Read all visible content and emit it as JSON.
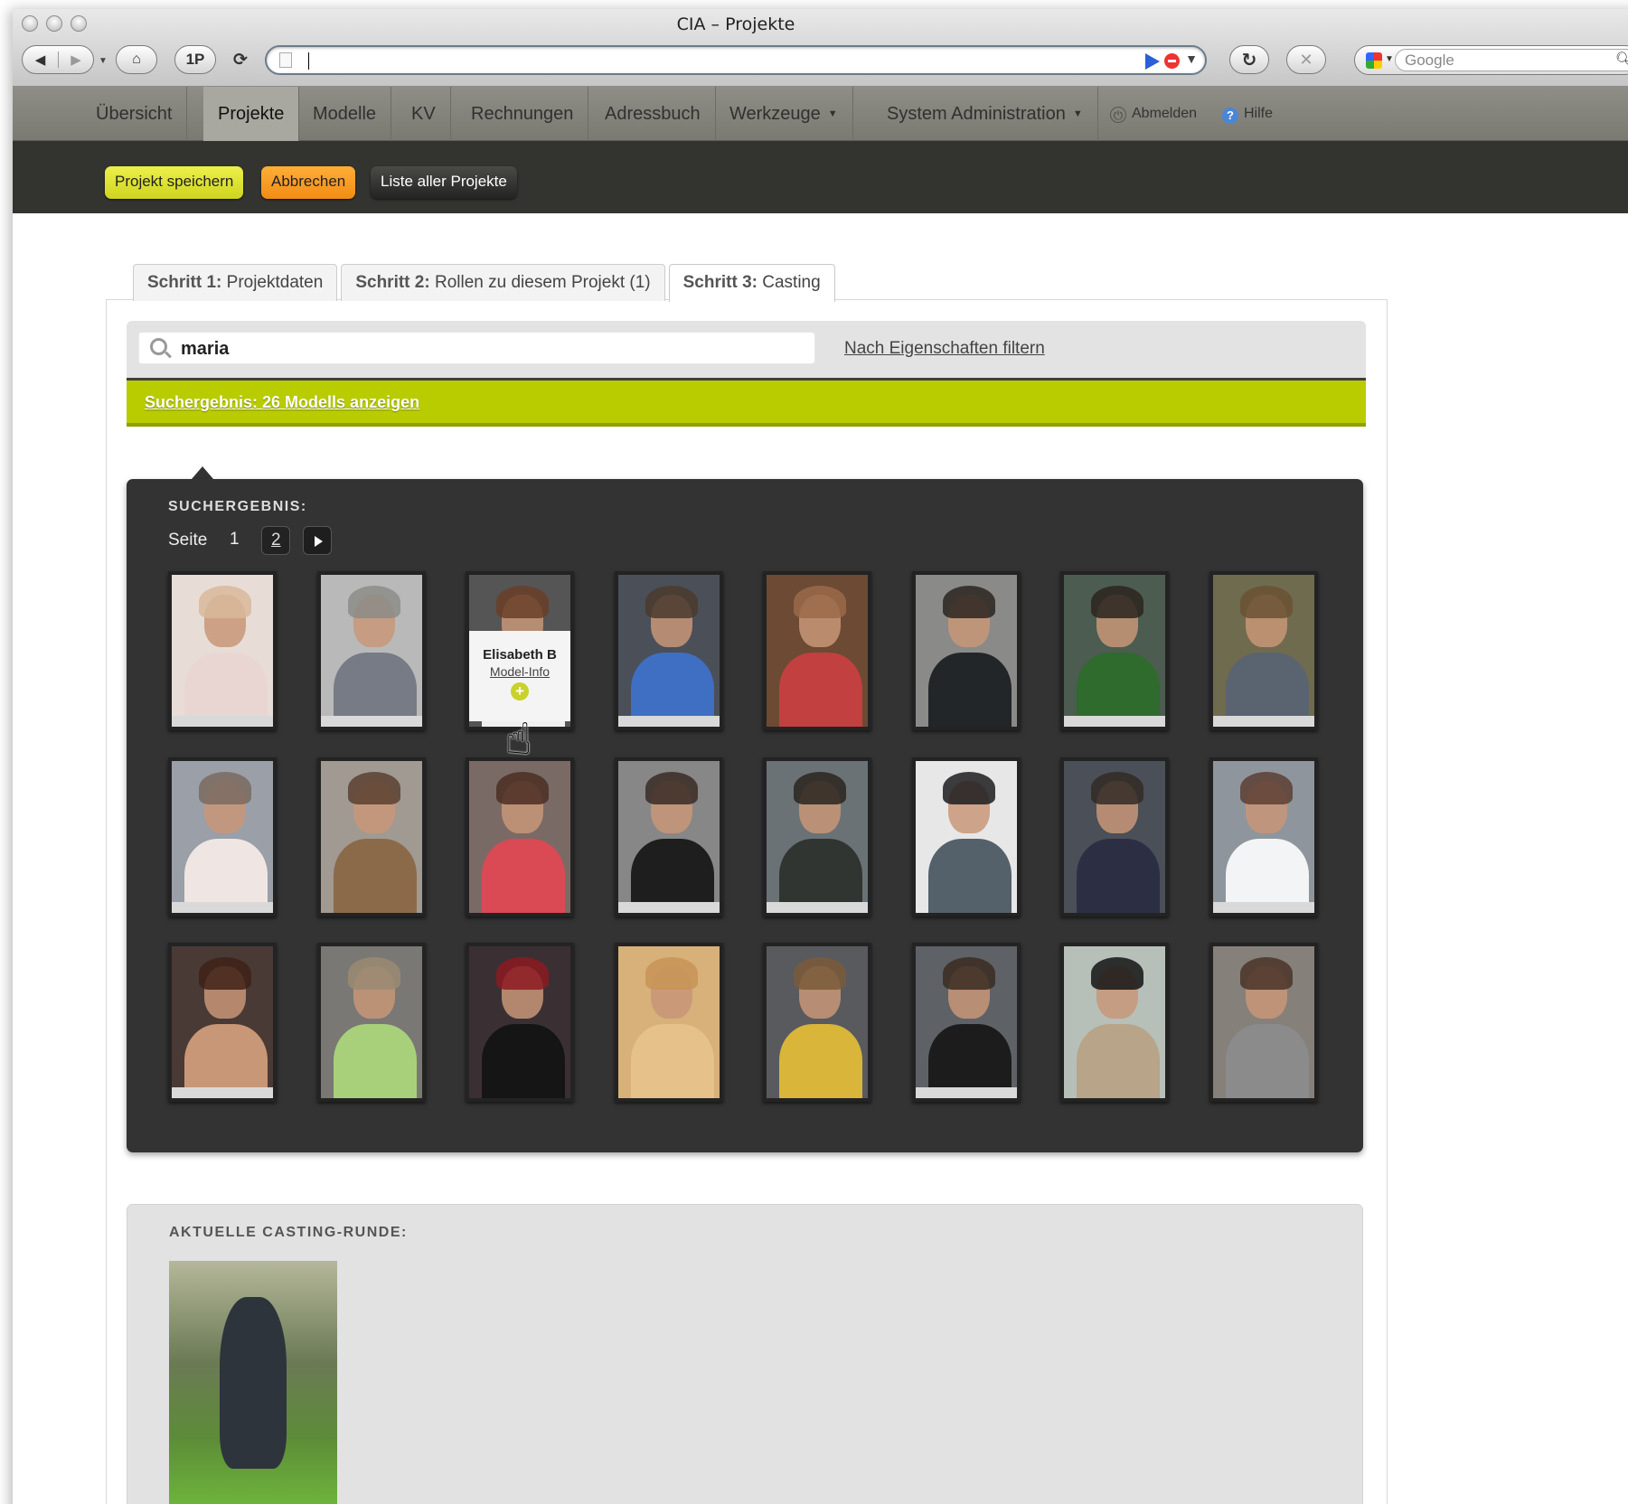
{
  "window": {
    "title": "CIA – Projekte"
  },
  "browser": {
    "url_value": "",
    "search_placeholder": "Google",
    "btn_1p": "1P"
  },
  "nav": {
    "items": [
      {
        "label": "Übersicht",
        "active": false
      },
      {
        "label": "Projekte",
        "active": true
      },
      {
        "label": "Modelle",
        "active": false
      },
      {
        "label": "KV",
        "active": false
      },
      {
        "label": "Rechnungen",
        "active": false
      },
      {
        "label": "Adressbuch",
        "active": false
      },
      {
        "label": "Werkzeuge",
        "active": false
      },
      {
        "label": "System Administration",
        "active": false
      }
    ],
    "logout": "Abmelden",
    "help": "Hilfe"
  },
  "actions": {
    "save": "Projekt speichern",
    "cancel": "Abbrechen",
    "list": "Liste aller Projekte"
  },
  "tabs": [
    {
      "step": "Schritt 1:",
      "label": "Projektdaten"
    },
    {
      "step": "Schritt 2:",
      "label": "Rollen zu diesem Projekt (1)"
    },
    {
      "step": "Schritt 3:",
      "label": "Casting"
    }
  ],
  "search": {
    "value": "maria",
    "filter_link": "Nach Eigenschaften filtern",
    "result_link": "Suchergebnis: 26 Modells anzeigen"
  },
  "results": {
    "heading": "SUCHERGEBNIS:",
    "page_label": "Seite",
    "pages": [
      "1",
      "2"
    ],
    "current_page": "2",
    "hover": {
      "name": "Elisabeth B",
      "info": "Model-Info",
      "add": "+"
    },
    "thumbs": [
      {
        "bg": "#e8dcd6",
        "hair": "#d8b89a",
        "body": "#e9d6d3"
      },
      {
        "bg": "#b9b9b9",
        "hair": "#8c8c88",
        "body": "#777b85"
      },
      {
        "bg": "#555",
        "hair": "#6a3f28",
        "body": "#efefef"
      },
      {
        "bg": "#4b4f58",
        "hair": "#4a3a2e",
        "body": "#3f6fc2"
      },
      {
        "bg": "#6d4a33",
        "hair": "#9a6a4a",
        "body": "#c24040"
      },
      {
        "bg": "#8a8a88",
        "hair": "#2a2420",
        "body": "#222629"
      },
      {
        "bg": "#4c5c50",
        "hair": "#2a241e",
        "body": "#2e6b2c"
      },
      {
        "bg": "#6f6b4e",
        "hair": "#6a5233",
        "body": "#5a6370"
      },
      {
        "bg": "#9a9fa8",
        "hair": "#7a6a60",
        "body": "#efe6e3"
      },
      {
        "bg": "#a09a92",
        "hair": "#5a4030",
        "body": "#8b6a4a"
      },
      {
        "bg": "#7a6a66",
        "hair": "#4a2e22",
        "body": "#d94a55"
      },
      {
        "bg": "#878787",
        "hair": "#3a2c26",
        "body": "#1e1e1e"
      },
      {
        "bg": "#6a7276",
        "hair": "#2a2420",
        "body": "#303532"
      },
      {
        "bg": "#e7e7e7",
        "hair": "#1c1c1e",
        "body": "#54606a"
      },
      {
        "bg": "#4a4f58",
        "hair": "#332a26",
        "body": "#2c2f44"
      },
      {
        "bg": "#8f959c",
        "hair": "#5c4034",
        "body": "#f3f4f6"
      },
      {
        "bg": "#4a3a36",
        "hair": "#3e2218",
        "body": "#c79777"
      },
      {
        "bg": "#7a7874",
        "hair": "#9a8a72",
        "body": "#a8d07a"
      },
      {
        "bg": "#3a3034",
        "hair": "#8c1a22",
        "body": "#151515"
      },
      {
        "bg": "#d8b07a",
        "hair": "#c89456",
        "body": "#e6c28a"
      },
      {
        "bg": "#585a5e",
        "hair": "#7a5a3a",
        "body": "#d9b53a"
      },
      {
        "bg": "#5e6266",
        "hair": "#3a2c22",
        "body": "#1c1c1c"
      },
      {
        "bg": "#b6c0b8",
        "hair": "#141414",
        "body": "#b8a488"
      },
      {
        "bg": "#85807a",
        "hair": "#4a3428",
        "body": "#8b8b8c"
      }
    ]
  },
  "casting": {
    "heading": "AKTUELLE CASTING-RUNDE:"
  },
  "colors": {
    "accent_green": "#b9cc00",
    "save_yellow": "#dbe02e",
    "cancel_orange": "#f5961c",
    "dark_bar": "#333330"
  }
}
